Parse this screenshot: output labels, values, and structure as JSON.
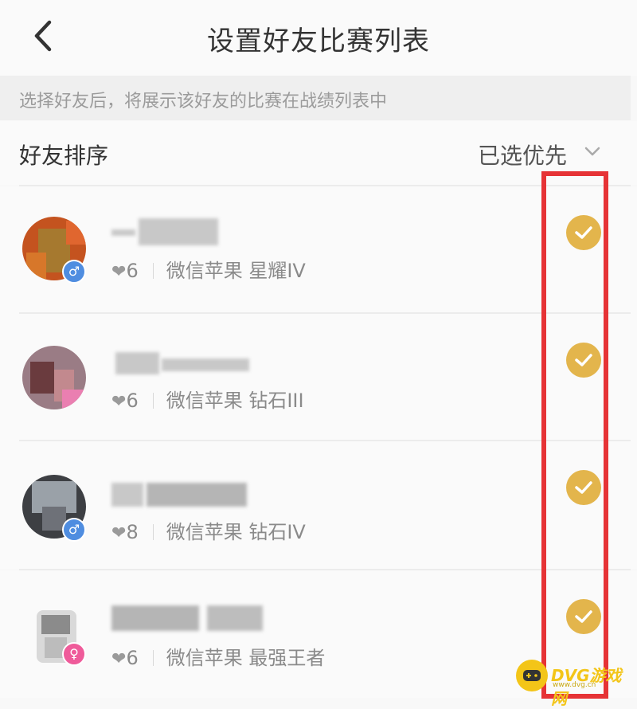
{
  "header": {
    "title": "设置好友比赛列表"
  },
  "notice": {
    "text": "选择好友后，将展示该好友的比赛在战绩列表中"
  },
  "sort": {
    "label": "好友排序",
    "value": "已选优先"
  },
  "friends": [
    {
      "heart": "❤",
      "likes": "6",
      "platform": "微信苹果",
      "rank": "星耀IV",
      "gender": "male",
      "selected": true
    },
    {
      "heart": "❤",
      "likes": "6",
      "platform": "微信苹果",
      "rank": "钻石III",
      "gender": "none",
      "selected": true
    },
    {
      "heart": "❤",
      "likes": "8",
      "platform": "微信苹果",
      "rank": "钻石IV",
      "gender": "male",
      "selected": true
    },
    {
      "heart": "❤",
      "likes": "6",
      "platform": "微信苹果",
      "rank": "最强王者",
      "gender": "female",
      "selected": true
    }
  ],
  "gender_symbols": {
    "male": "♂",
    "female": "♀"
  },
  "watermark": {
    "text": "DVG游戏网",
    "sub": "www.dvg.cn"
  },
  "colors": {
    "accent": "#e3b54c",
    "highlight": "#e63336",
    "watermark": "#f3c518"
  }
}
